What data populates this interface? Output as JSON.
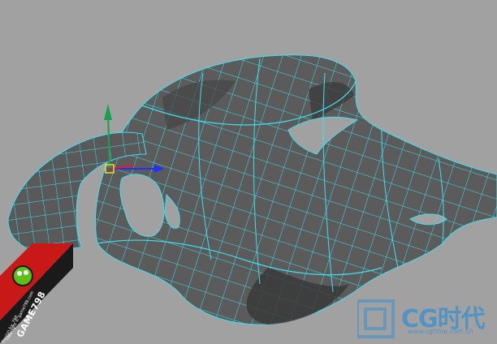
{
  "viewport": {
    "background": "#a1a1a1",
    "mesh_fill": "#5a5a5a",
    "mesh_fill_dark": "#3c3c3c",
    "wire_color": "#3fe0f0"
  },
  "watermark_left": {
    "brand": "GAME798",
    "copyright_line1": "copyright © game798.com",
    "copyright_line2": "Design by: 798"
  },
  "watermark_right": {
    "brand": "CG时代",
    "url": "www.cgtime.com.cn",
    "accent": "#3a8fd0"
  },
  "gizmo": {
    "x_color": "#2030ff",
    "y_color": "#18a050",
    "z_color": "#e02020"
  }
}
